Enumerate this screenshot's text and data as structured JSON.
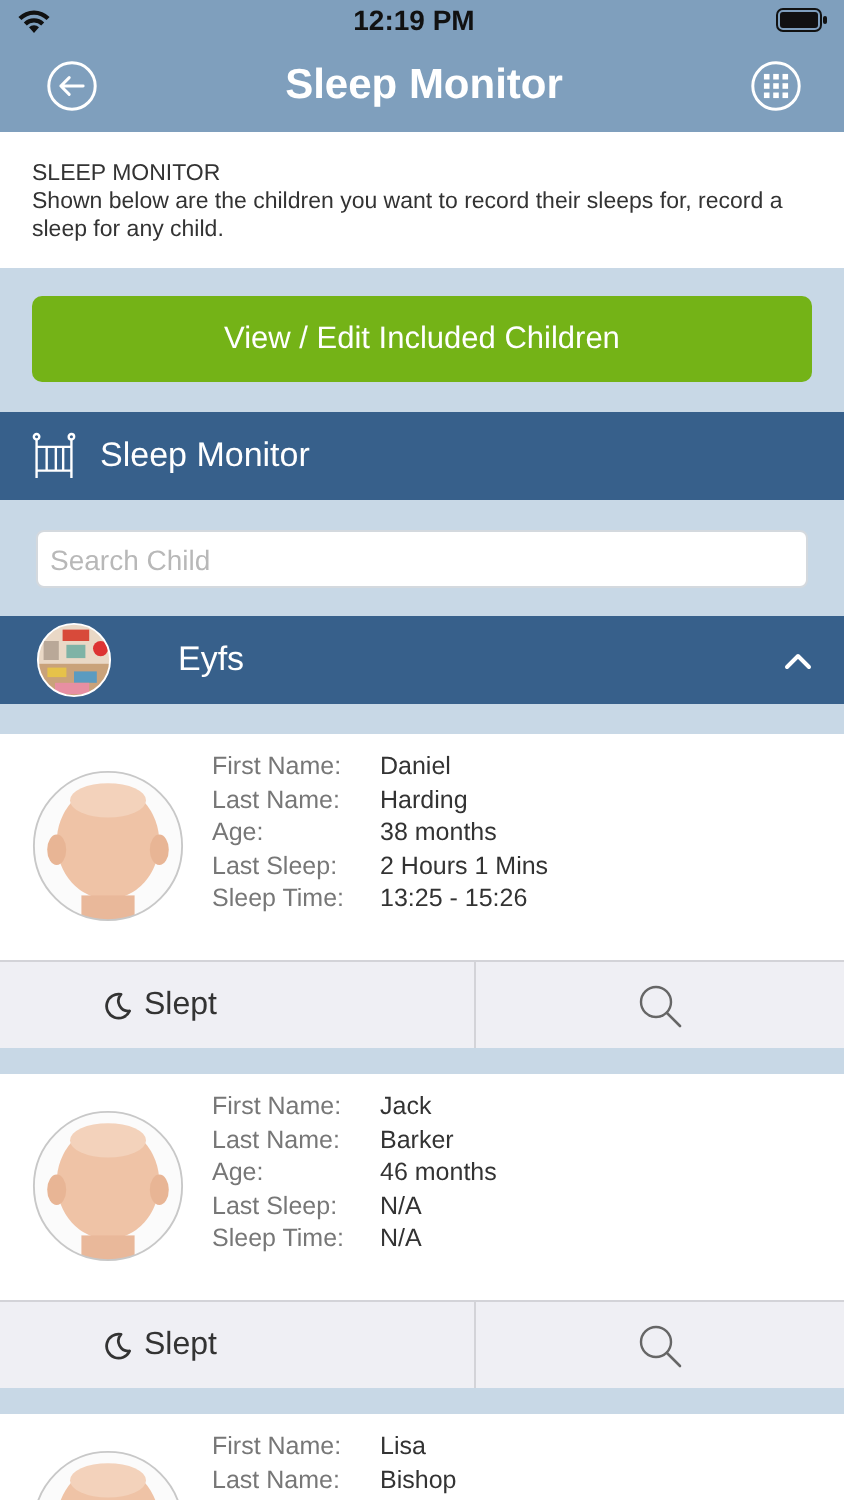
{
  "status_bar": {
    "time": "12:19 PM"
  },
  "nav_bar": {
    "title": "Sleep Monitor"
  },
  "intro": {
    "heading": "SLEEP MONITOR",
    "text": "Shown below are the children you want to record their sleeps for, record a sleep for any child."
  },
  "primary_button": "View / Edit Included Children",
  "section_header": {
    "title": "Sleep Monitor"
  },
  "search": {
    "placeholder": "Search Child"
  },
  "group": {
    "name": "Eyfs",
    "expanded": true,
    "photo": {
      "kind": "picture"
    }
  },
  "children": [
    {
      "photo": {
        "kind": "picture"
      },
      "fields": [
        {
          "label": "First Name:",
          "value": "Daniel"
        },
        {
          "label": "Last Name:",
          "value": "Harding"
        },
        {
          "label": "Age:",
          "value": "38 months"
        },
        {
          "label": "Last Sleep:",
          "value": "2 Hours 1 Mins"
        },
        {
          "label": "Sleep Time:",
          "value": "13:25 - 15:26"
        }
      ],
      "actions": {
        "slept": "Slept"
      }
    },
    {
      "photo": {
        "kind": "picture"
      },
      "fields": [
        {
          "label": "First Name:",
          "value": "Jack"
        },
        {
          "label": "Last Name:",
          "value": "Barker"
        },
        {
          "label": "Age:",
          "value": "46 months"
        },
        {
          "label": "Last Sleep:",
          "value": "N/A"
        },
        {
          "label": "Sleep Time:",
          "value": "N/A"
        }
      ],
      "actions": {
        "slept": "Slept"
      }
    },
    {
      "photo": {
        "kind": "picture"
      },
      "fields": [
        {
          "label": "First Name:",
          "value": "Lisa"
        },
        {
          "label": "Last Name:",
          "value": "Bishop"
        }
      ]
    }
  ]
}
